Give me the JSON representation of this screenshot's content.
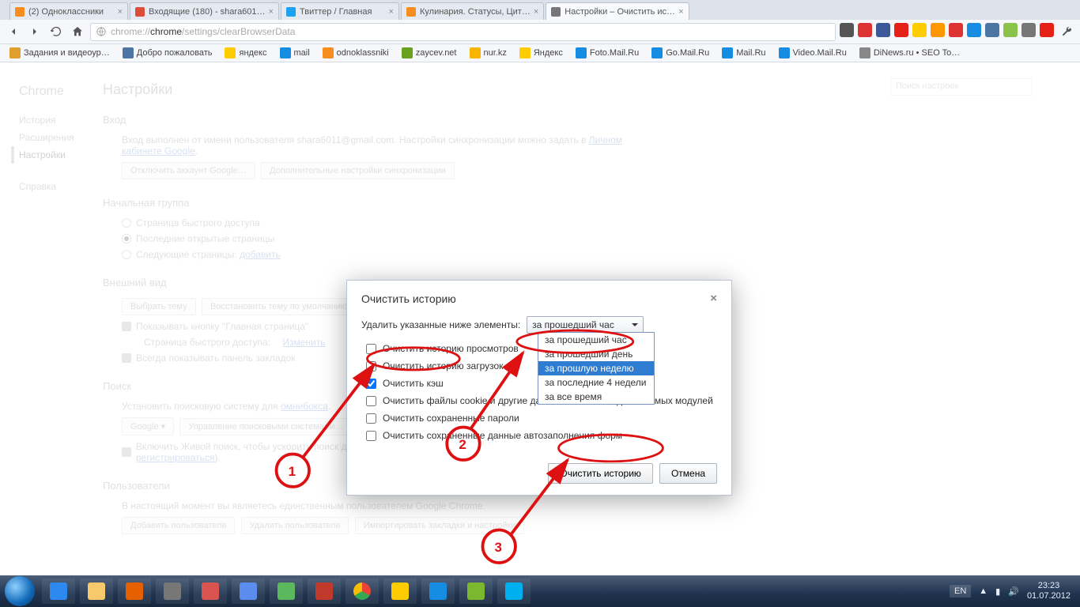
{
  "tabs": [
    {
      "title": "(2) Одноклассники",
      "fav": "#f78c1f"
    },
    {
      "title": "Входящие (180) - shara601…",
      "fav": "#dd4b39"
    },
    {
      "title": "Твиттер / Главная",
      "fav": "#1da1f2"
    },
    {
      "title": "Кулинария. Статусы, Цит…",
      "fav": "#f78c1f"
    },
    {
      "title": "Настройки – Очистить ис…",
      "fav": "#777",
      "active": true
    }
  ],
  "url": "chrome://chrome/settings/clearBrowserData",
  "bookmarks": [
    {
      "label": "Задания и видеоур…",
      "c": "#e0a030"
    },
    {
      "label": "Добро пожаловать",
      "c": "#4c75a3"
    },
    {
      "label": "яндекс",
      "c": "#ffcc00"
    },
    {
      "label": "mail",
      "c": "#168de2"
    },
    {
      "label": "odnoklassniki",
      "c": "#f78c1f"
    },
    {
      "label": "zaycev.net",
      "c": "#6aa121"
    },
    {
      "label": "nur.kz",
      "c": "#f7b500"
    },
    {
      "label": "Яндекс",
      "c": "#ffcc00"
    },
    {
      "label": "Foto.Mail.Ru",
      "c": "#168de2"
    },
    {
      "label": "Go.Mail.Ru",
      "c": "#168de2"
    },
    {
      "label": "Mail.Ru",
      "c": "#168de2"
    },
    {
      "label": "Video.Mail.Ru",
      "c": "#168de2"
    },
    {
      "label": "DiNews.ru • SEO To…",
      "c": "#888"
    }
  ],
  "side": {
    "brand": "Chrome",
    "items": [
      "История",
      "Расширения",
      "Настройки"
    ],
    "sel": 2,
    "help": "Справка"
  },
  "page": {
    "title": "Настройки",
    "search_placeholder": "Поиск настроек",
    "login_h": "Вход",
    "login_txt_a": "Вход выполнен от имени пользователя shara6011@gmail.com. Настройки синхронизации можно задать в ",
    "login_link": "Личном кабинете Google",
    "login_btn1": "Отключить аккаунт Google…",
    "login_btn2": "Дополнительные настройки синхронизации",
    "startup_h": "Начальная группа",
    "startup_opts": [
      "Страница быстрого доступа",
      "Последние открытые страницы",
      "Следующие страницы:"
    ],
    "startup_add": "добавить",
    "look_h": "Внешний вид",
    "look_btn1": "Выбрать тему",
    "look_btn2": "Восстановить тему по умолчанию",
    "look_chk1": "Показывать кнопку \"Главная страница\"",
    "look_fast": "Страница быстрого доступа:",
    "look_change": "Изменить",
    "look_chk2": "Всегда показывать панель закладок",
    "search_h": "Поиск",
    "search_txt": "Установить поисковую систему для ",
    "search_omni": "омнибокса",
    "search_engine": "Google",
    "search_manage": "Управление поисковыми системами…",
    "search_live_a": "Включить Живой поиск, чтобы ускорить поиск данных (введенные в омнибокс данные могут ",
    "search_live_link": "регистрироваться",
    "users_h": "Пользователи",
    "users_txt": "В настоящий момент вы являетесь единственным пользователем Google Chrome.",
    "users_btn1": "Добавить пользователя",
    "users_btn2": "Удалить пользователя",
    "users_btn3": "Импортировать закладки и настройки"
  },
  "modal": {
    "title": "Очистить историю",
    "close": "×",
    "del_label": "Удалить указанные ниже элементы:",
    "select_value": "за прошедший час",
    "options": [
      "за прошедший час",
      "за прошедший день",
      "за прошлую неделю",
      "за последние 4 недели",
      "за все время"
    ],
    "opt_hi": 2,
    "checks": [
      {
        "label": "Очистить историю просмотров",
        "on": false
      },
      {
        "label": "Очистить историю загрузок",
        "on": false
      },
      {
        "label": "Очистить кэш",
        "on": true
      },
      {
        "label": "Очистить файлы cookie и другие данные сайтов и подключаемых модулей",
        "on": false
      },
      {
        "label": "Очистить сохраненные пароли",
        "on": false
      },
      {
        "label": "Очистить сохраненные данные автозаполнения форм",
        "on": false
      }
    ],
    "primary": "Очистить историю",
    "cancel": "Отмена"
  },
  "anno": {
    "n1": "1",
    "n2": "2",
    "n3": "3"
  },
  "tray": {
    "lang": "EN",
    "time": "23:23",
    "date": "01.07.2012"
  }
}
